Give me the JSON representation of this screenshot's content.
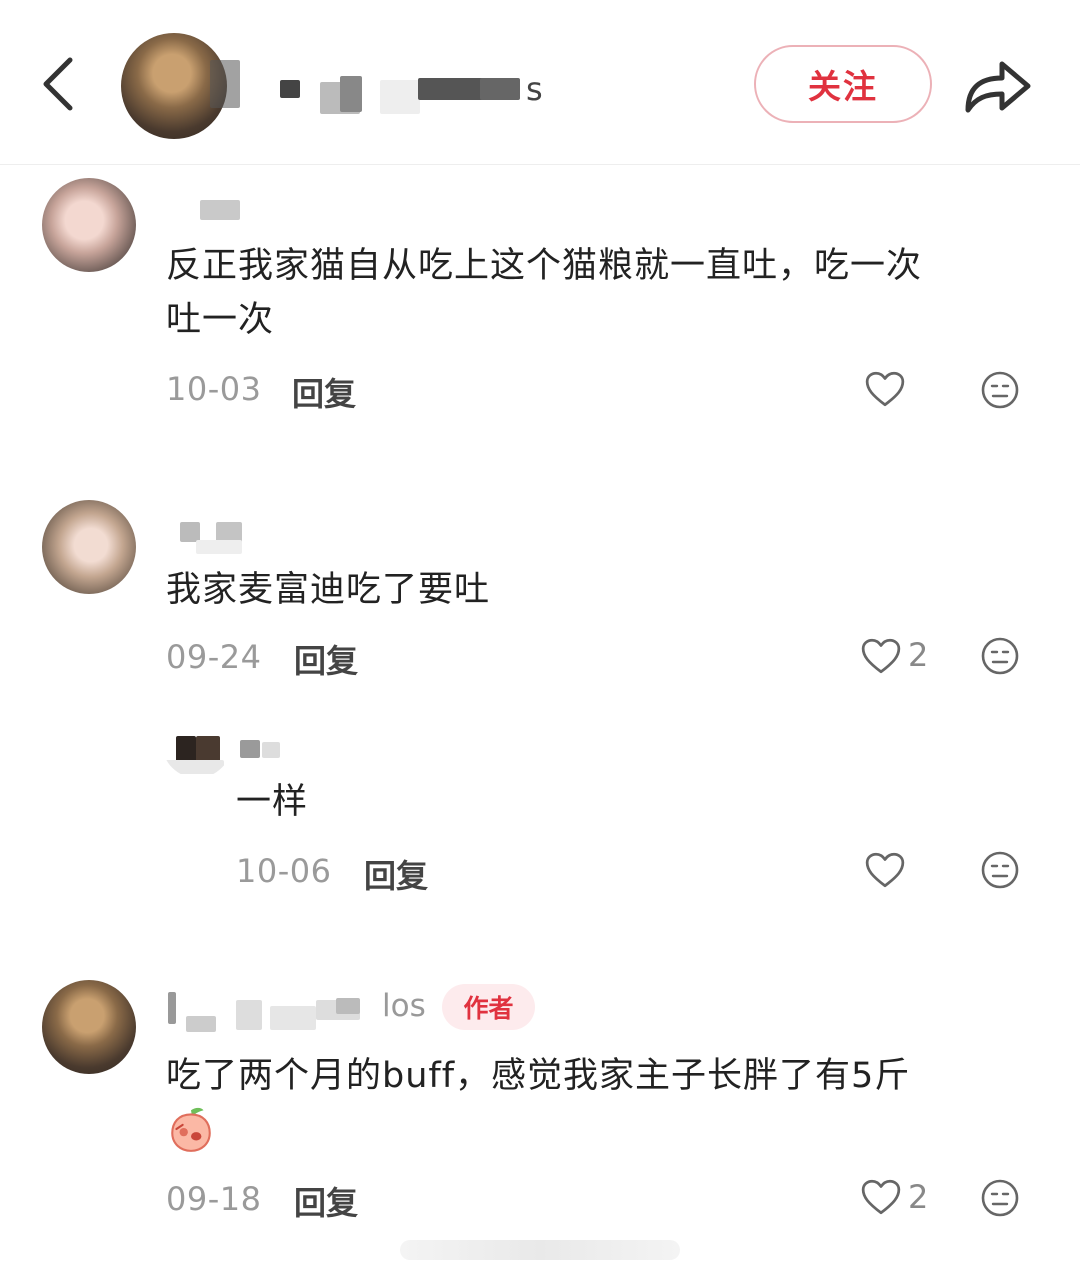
{
  "header": {
    "username_tail": "s",
    "follow_label": "关注"
  },
  "comments": [
    {
      "text": "反正我家猫自从吃上这个猫粮就一直吐，吃一次吐一次",
      "line1": "反正我家猫自从吃上这个猫粮就一直吐，吃一次",
      "line2": "吐一次",
      "date": "10-03",
      "reply_label": "回复",
      "likes": ""
    },
    {
      "text": "我家麦富迪吃了要吐",
      "date": "09-24",
      "reply_label": "回复",
      "likes": "2",
      "replies": [
        {
          "text": "一样",
          "date": "10-06",
          "reply_label": "回复",
          "likes": ""
        }
      ]
    },
    {
      "username_tail": "los",
      "author_tag": "作者",
      "text": "吃了两个月的buff，感觉我家主子长胖了有5斤",
      "date": "09-18",
      "reply_label": "回复",
      "likes": "2"
    }
  ],
  "icons": {
    "back": "chevron-left-icon",
    "share": "share-arrow-icon",
    "like": "heart-outline-icon",
    "dislike": "meh-face-icon",
    "emoji": "peach-sticker-emoji"
  },
  "colors": {
    "accent": "#e0323f",
    "follow_border": "#ecb1b7",
    "author_tag_bg": "#fdebed",
    "date": "#9a9a9a",
    "icon": "#666666"
  }
}
